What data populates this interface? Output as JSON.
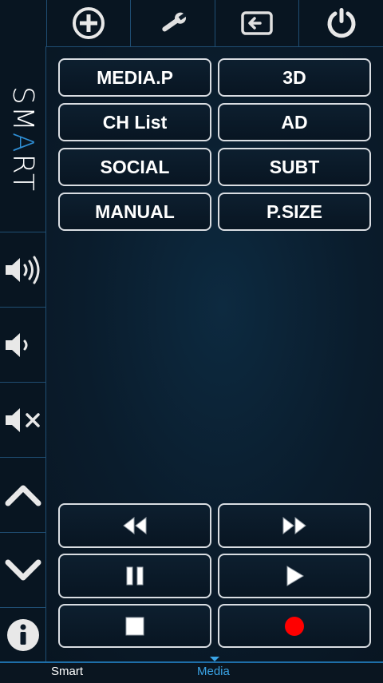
{
  "top_toolbar": {
    "items": [
      {
        "icon": "plus-circle-icon"
      },
      {
        "icon": "wrench-icon"
      },
      {
        "icon": "input-source-icon"
      },
      {
        "icon": "power-icon"
      }
    ]
  },
  "sidebar": {
    "logo_prefix": "SM",
    "logo_accent": "A",
    "logo_suffix": "RT",
    "buttons": [
      {
        "icon": "volume-up-icon"
      },
      {
        "icon": "volume-down-icon"
      },
      {
        "icon": "mute-icon"
      },
      {
        "icon": "chevron-up-icon"
      },
      {
        "icon": "chevron-down-icon"
      },
      {
        "icon": "info-icon"
      }
    ]
  },
  "function_buttons": [
    {
      "label": "MEDIA.P"
    },
    {
      "label": "3D"
    },
    {
      "label": "CH List"
    },
    {
      "label": "AD"
    },
    {
      "label": "SOCIAL"
    },
    {
      "label": "SUBT"
    },
    {
      "label": "MANUAL"
    },
    {
      "label": "P.SIZE"
    }
  ],
  "playback_buttons": [
    {
      "icon": "rewind-icon"
    },
    {
      "icon": "fast-forward-icon"
    },
    {
      "icon": "pause-icon"
    },
    {
      "icon": "play-icon"
    },
    {
      "icon": "stop-icon"
    },
    {
      "icon": "record-icon"
    }
  ],
  "tabs": {
    "smart": "Smart",
    "media": "Media",
    "active": "media"
  },
  "colors": {
    "accent": "#3aa4e6",
    "record": "#ff0000",
    "logo_accent": "#2f8fd6"
  }
}
